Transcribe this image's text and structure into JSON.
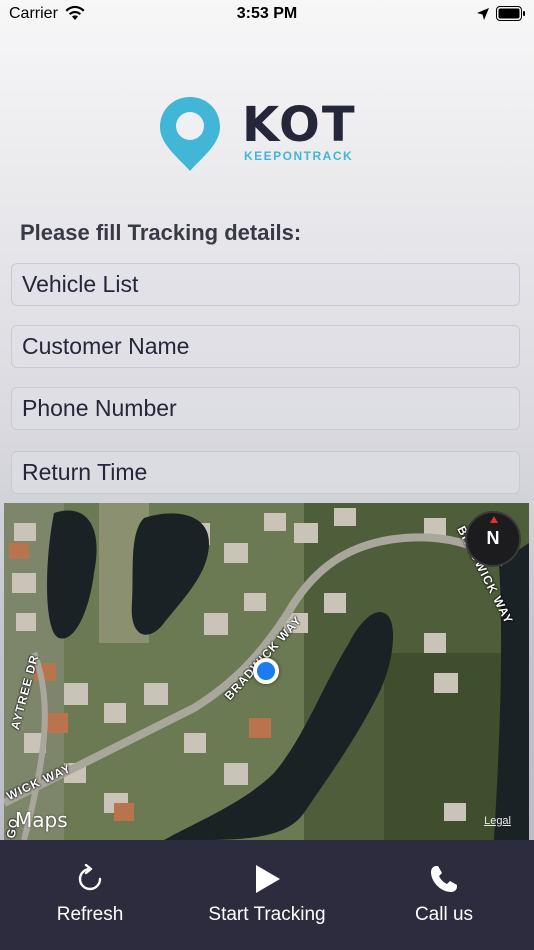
{
  "status_bar": {
    "carrier": "Carrier",
    "time": "3:53 PM"
  },
  "logo": {
    "brand": "KOT",
    "tagline": "KEEPONTRACK",
    "pin_color": "#41b6d6"
  },
  "form": {
    "title": "Please fill Tracking details:",
    "fields": [
      {
        "placeholder": "Vehicle List",
        "value": ""
      },
      {
        "placeholder": "Customer Name",
        "value": ""
      },
      {
        "placeholder": "Phone Number",
        "value": ""
      },
      {
        "placeholder": "Return Time",
        "value": ""
      }
    ]
  },
  "map": {
    "streets": [
      "BRADWICK WAY",
      "BRADWICK WAY",
      "AYTREE DR",
      "WICK WAY",
      "GO"
    ],
    "compass_label": "N",
    "brand": "Maps",
    "legal": "Legal"
  },
  "toolbar": {
    "refresh_label": "Refresh",
    "start_label": "Start Tracking",
    "call_label": "Call us",
    "background": "#2c2c3e"
  }
}
